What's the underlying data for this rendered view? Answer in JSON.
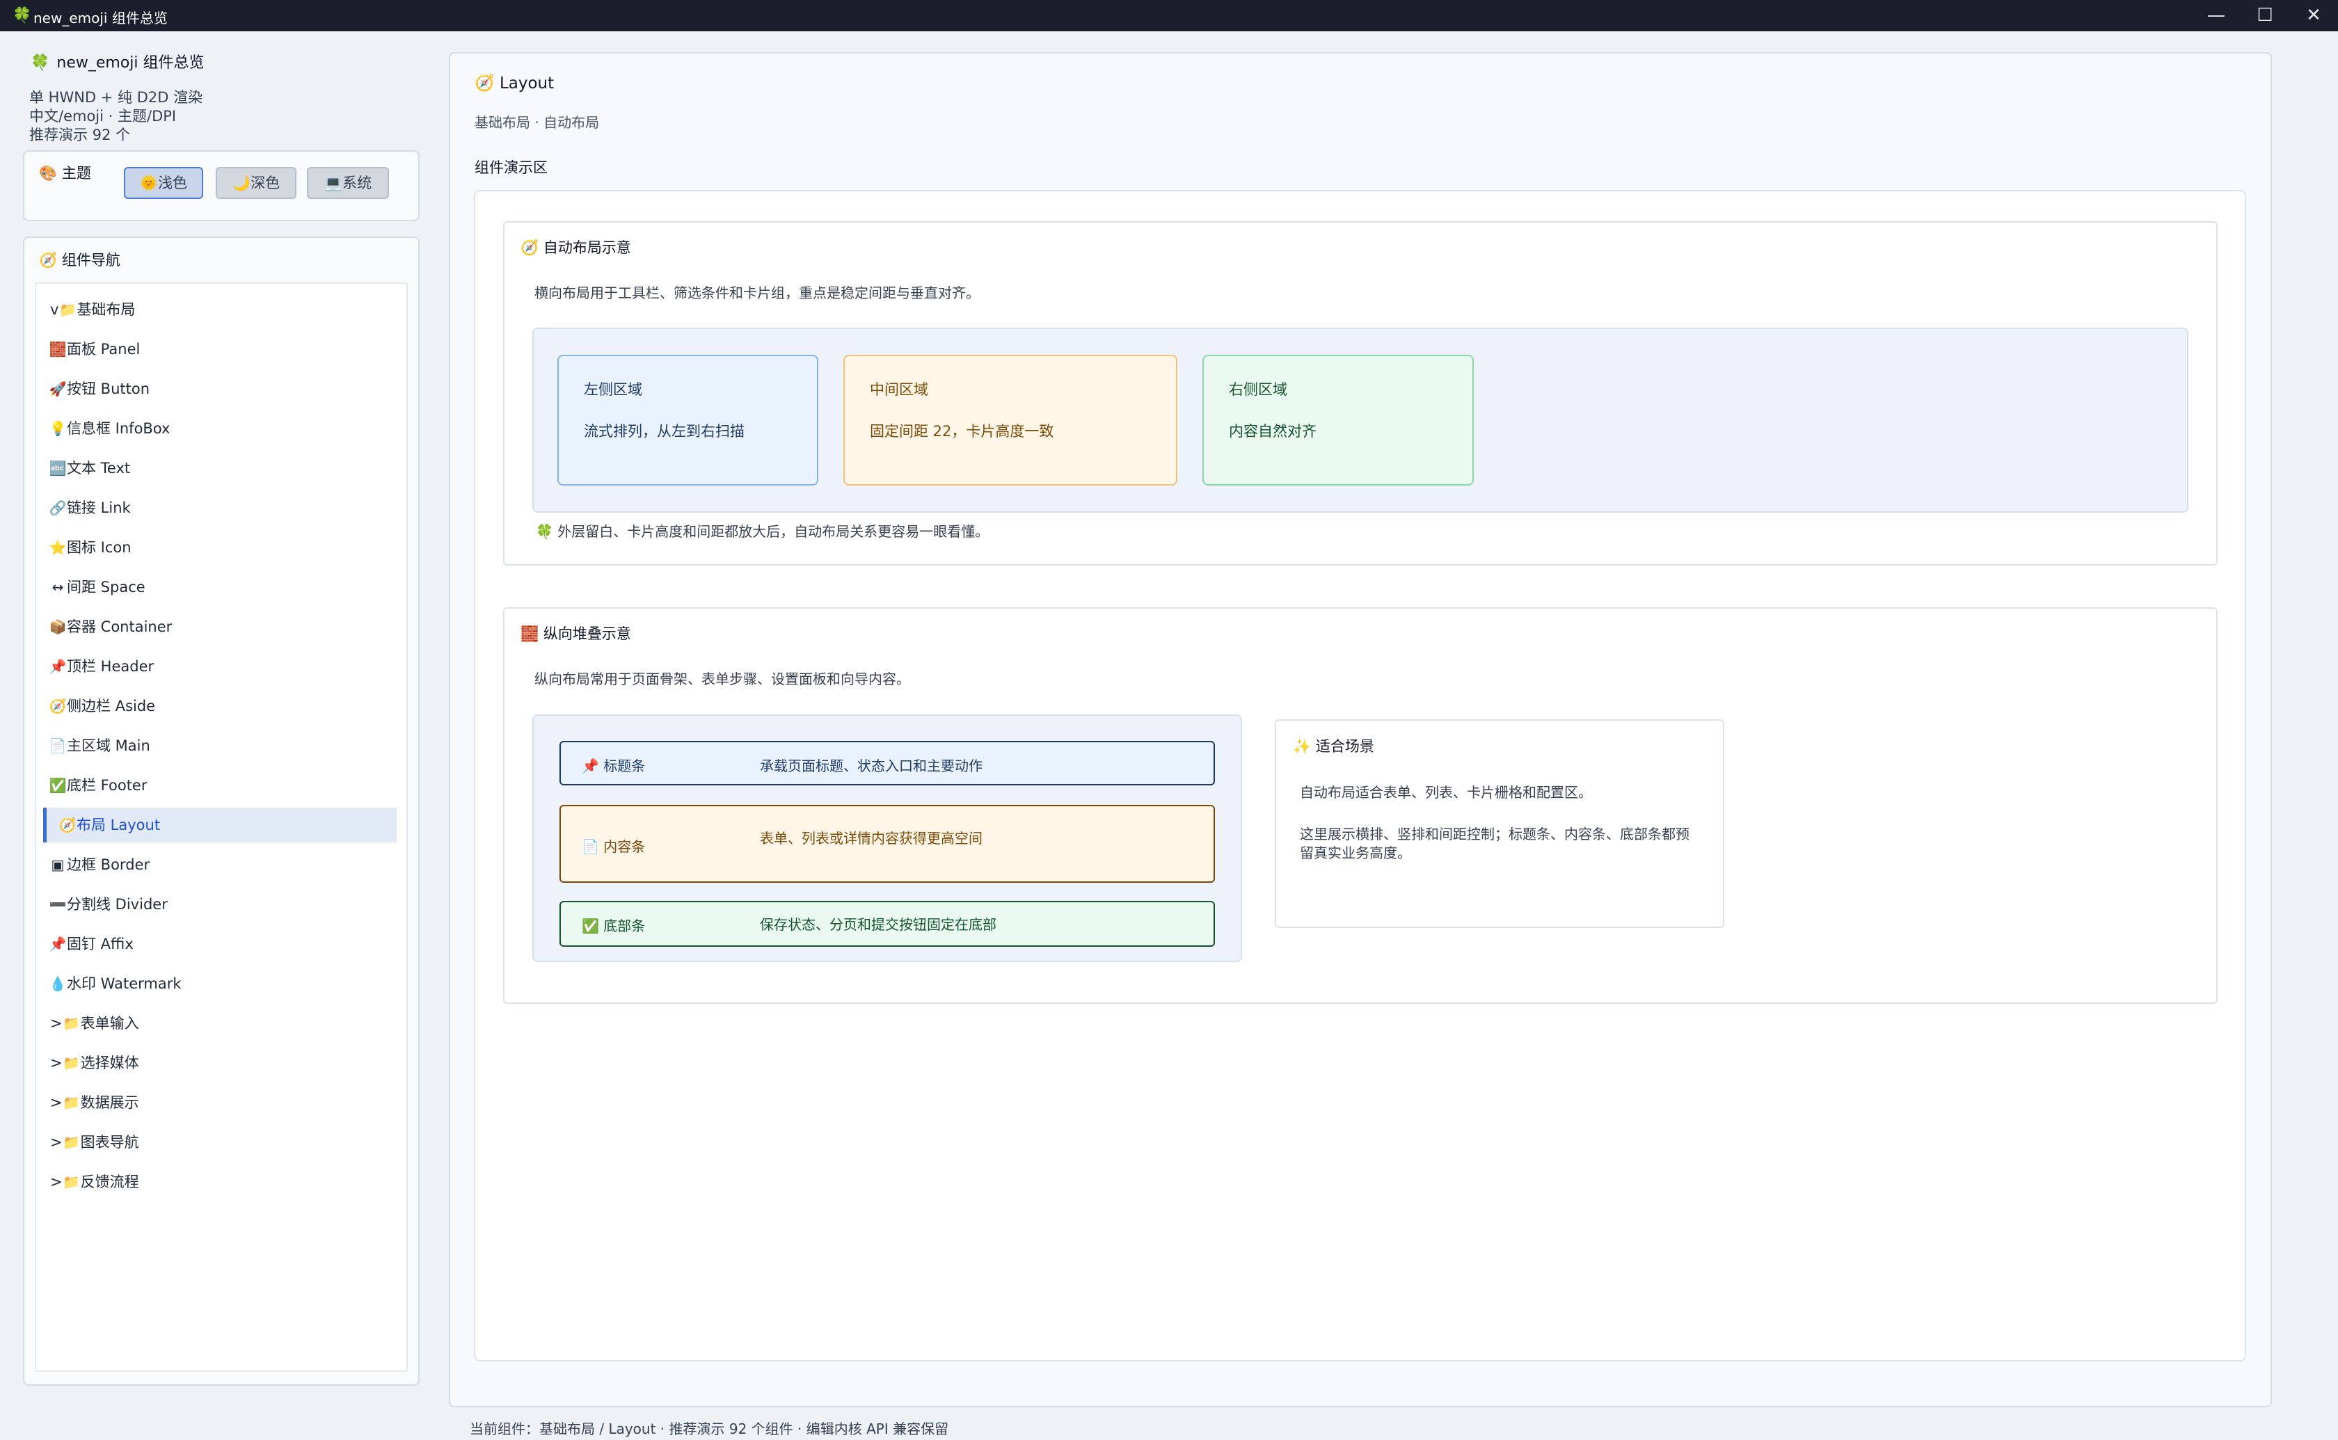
{
  "window": {
    "title": "new_emoji 组件总览",
    "logo_icon": "🍀",
    "minimize": "—",
    "maximize": "☐",
    "close": "✕"
  },
  "sidebar": {
    "app_icon": "🍀",
    "app_title": "new_emoji 组件总览",
    "meta_lines": [
      "单 HWND + 纯 D2D 渲染",
      "中文/emoji · 主题/DPI",
      "推荐演示 92 个"
    ],
    "theme": {
      "icon": "🎨",
      "label": "主题",
      "buttons": [
        {
          "icon": "🌞",
          "label": "浅色",
          "active": true
        },
        {
          "icon": "🌙",
          "label": "深色",
          "active": false
        },
        {
          "icon": "💻",
          "label": "系统",
          "active": false
        }
      ]
    },
    "nav": {
      "icon": "🧭",
      "title": "组件导航",
      "groups": [
        {
          "prefix": "v",
          "icon": "📁",
          "label": "基础布局"
        },
        {
          "prefix": ">",
          "icon": "📁",
          "label": "表单输入"
        },
        {
          "prefix": ">",
          "icon": "📁",
          "label": "选择媒体"
        },
        {
          "prefix": ">",
          "icon": "📁",
          "label": "数据展示"
        },
        {
          "prefix": ">",
          "icon": "📁",
          "label": "图表导航"
        },
        {
          "prefix": ">",
          "icon": "📁",
          "label": "反馈流程"
        }
      ],
      "items": [
        {
          "icon": "🧱",
          "label": "面板 Panel"
        },
        {
          "icon": "🚀",
          "label": "按钮 Button"
        },
        {
          "icon": "💡",
          "label": "信息框 InfoBox"
        },
        {
          "icon": "🔤",
          "label": "文本 Text"
        },
        {
          "icon": "🔗",
          "label": "链接 Link"
        },
        {
          "icon": "⭐",
          "label": "图标 Icon"
        },
        {
          "icon": "↔",
          "label": "间距 Space"
        },
        {
          "icon": "📦",
          "label": "容器 Container"
        },
        {
          "icon": "📌",
          "label": "顶栏 Header"
        },
        {
          "icon": "🧭",
          "label": "侧边栏 Aside"
        },
        {
          "icon": "📄",
          "label": "主区域 Main"
        },
        {
          "icon": "✅",
          "label": "底栏 Footer"
        },
        {
          "icon": "🧭",
          "label": "布局 Layout"
        },
        {
          "icon": "▣",
          "label": "边框 Border"
        },
        {
          "icon": "➖",
          "label": "分割线 Divider"
        },
        {
          "icon": "📌",
          "label": "固钉 Affix"
        },
        {
          "icon": "💧",
          "label": "水印 Watermark"
        }
      ],
      "selected_index": 12
    }
  },
  "main": {
    "icon": "🧭",
    "title": "Layout",
    "breadcrumb": "基础布局 · 自动布局",
    "demo_label": "组件演示区",
    "auto_section": {
      "icon": "🧭",
      "title": "自动布局示意",
      "desc": "横向布局用于工具栏、筛选条件和卡片组，重点是稳定间距与垂直对齐。",
      "cards": [
        {
          "title": "左侧区域",
          "desc": "流式排列，从左到右扫描"
        },
        {
          "title": "中间区域",
          "desc": "固定间距 22，卡片高度一致"
        },
        {
          "title": "右侧区域",
          "desc": "内容自然对齐"
        }
      ],
      "note_icon": "🍀",
      "note": "外层留白、卡片高度和间距都放大后，自动布局关系更容易一眼看懂。"
    },
    "stack_section": {
      "icon": "🧱",
      "title": "纵向堆叠示意",
      "desc": "纵向布局常用于页面骨架、表单步骤、设置面板和向导内容。",
      "bars": [
        {
          "icon": "📌",
          "label": "标题条",
          "desc": "承载页面标题、状态入口和主要动作"
        },
        {
          "icon": "📄",
          "label": "内容条",
          "desc": "表单、列表或详情内容获得更高空间"
        },
        {
          "icon": "✅",
          "label": "底部条",
          "desc": "保存状态、分页和提交按钮固定在底部"
        }
      ],
      "scene": {
        "icon": "✨",
        "title": "适合场景",
        "p1": "自动布局适合表单、列表、卡片栅格和配置区。",
        "p2": "这里展示横排、竖排和间距控制；标题条、内容条、底部条都预留真实业务高度。"
      }
    }
  },
  "status_bar": "当前组件：基础布局 / Layout · 推荐演示 92 个组件 · 编辑内核 API 兼容保留"
}
